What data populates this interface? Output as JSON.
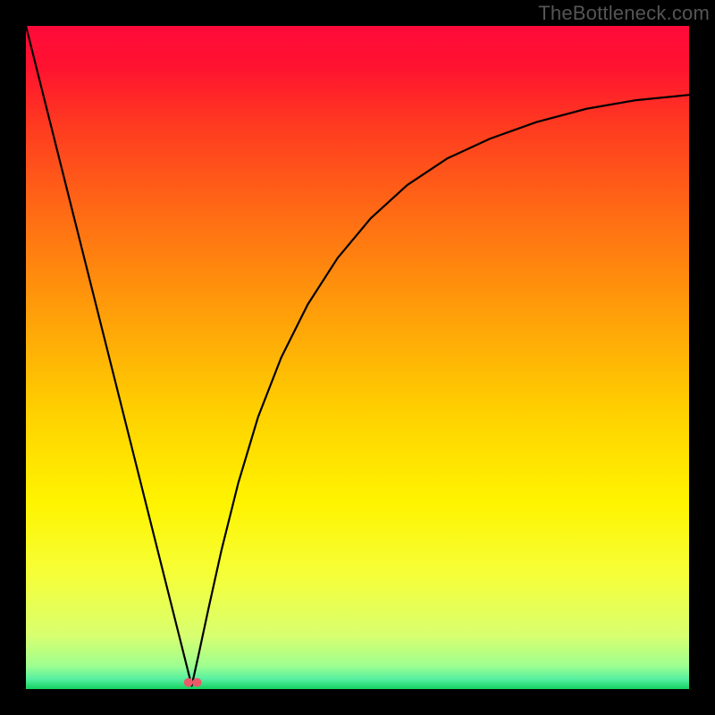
{
  "watermark": "TheBottleneck.com",
  "chart_data": {
    "type": "line",
    "title": "",
    "xlabel": "",
    "ylabel": "",
    "xlim": [
      0,
      1
    ],
    "ylim": [
      0,
      1
    ],
    "gradient_stops": [
      {
        "pos": 0.0,
        "color": "#ff0a3a"
      },
      {
        "pos": 0.06,
        "color": "#ff1230"
      },
      {
        "pos": 0.15,
        "color": "#ff3a20"
      },
      {
        "pos": 0.28,
        "color": "#ff6a15"
      },
      {
        "pos": 0.42,
        "color": "#ff9a0a"
      },
      {
        "pos": 0.58,
        "color": "#ffd000"
      },
      {
        "pos": 0.72,
        "color": "#fff400"
      },
      {
        "pos": 0.83,
        "color": "#f5ff3a"
      },
      {
        "pos": 0.92,
        "color": "#d8ff70"
      },
      {
        "pos": 0.965,
        "color": "#9eff90"
      },
      {
        "pos": 0.985,
        "color": "#55f0a0"
      },
      {
        "pos": 1.0,
        "color": "#14d060"
      }
    ],
    "series": [
      {
        "name": "left-segment",
        "stroke": "#000000",
        "x": [
          0.0,
          0.25
        ],
        "y": [
          1.0,
          0.005
        ]
      },
      {
        "name": "right-curve",
        "stroke": "#000000",
        "x": [
          0.25,
          0.26,
          0.275,
          0.295,
          0.32,
          0.35,
          0.385,
          0.425,
          0.47,
          0.52,
          0.575,
          0.635,
          0.7,
          0.77,
          0.845,
          0.92,
          1.0
        ],
        "y": [
          0.005,
          0.05,
          0.12,
          0.21,
          0.31,
          0.41,
          0.5,
          0.58,
          0.65,
          0.71,
          0.76,
          0.8,
          0.83,
          0.855,
          0.875,
          0.888,
          0.896
        ]
      }
    ],
    "markers": [
      {
        "name": "vertex-dot-1",
        "x": 0.245,
        "y": 0.01,
        "r": 5,
        "fill": "#ec5a6a"
      },
      {
        "name": "vertex-dot-2",
        "x": 0.258,
        "y": 0.01,
        "r": 5,
        "fill": "#ec5a6a"
      }
    ]
  }
}
